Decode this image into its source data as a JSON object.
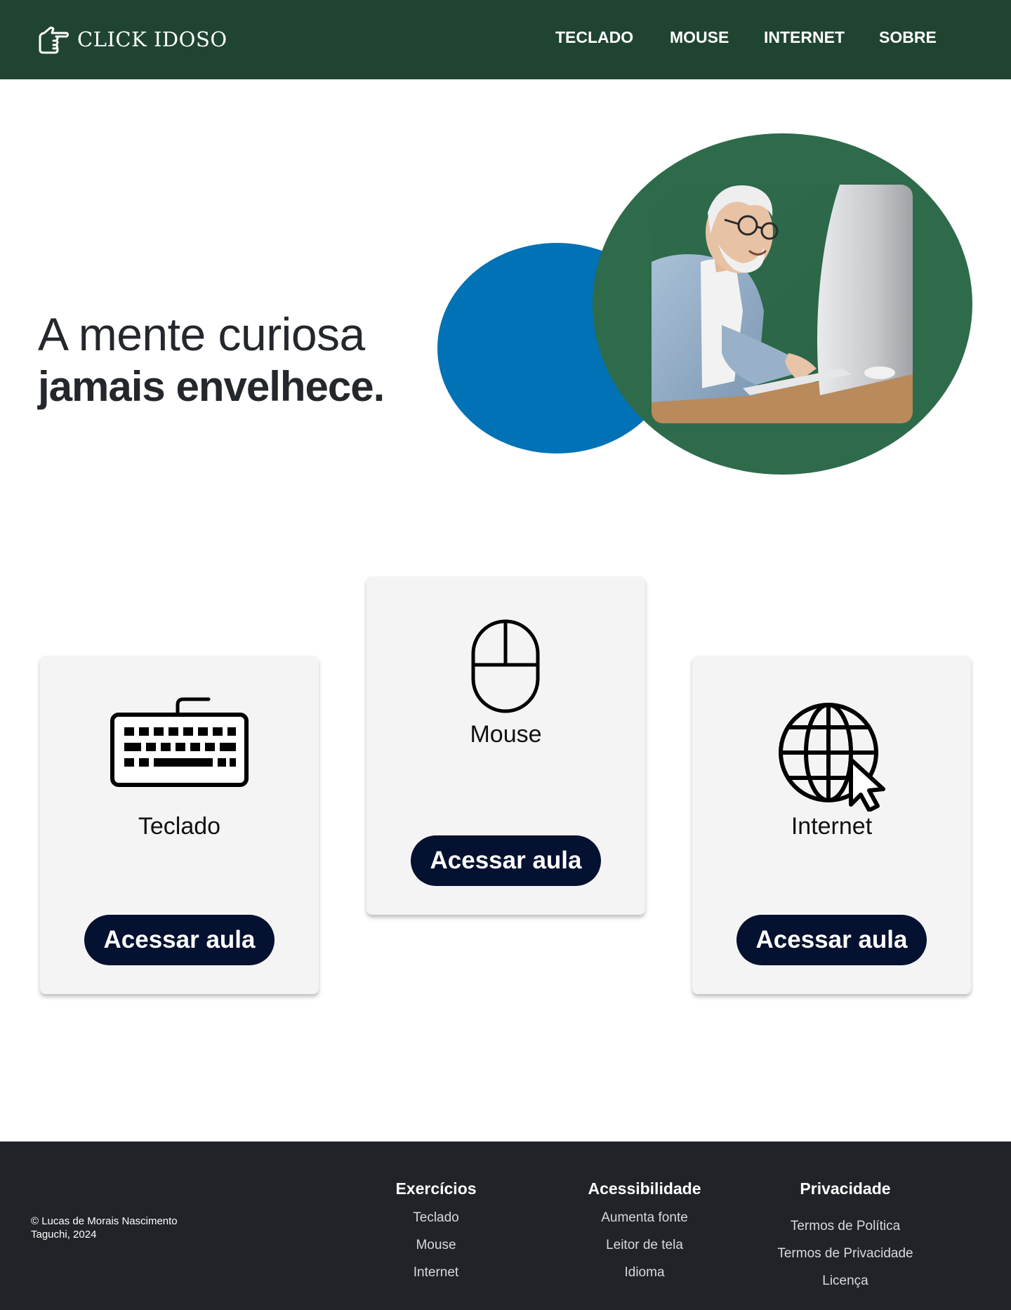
{
  "header": {
    "brand": "CLICK IDOSO",
    "nav": [
      {
        "label": "TECLADO"
      },
      {
        "label": "MOUSE"
      },
      {
        "label": "INTERNET"
      },
      {
        "label": "SOBRE"
      }
    ]
  },
  "hero": {
    "line1": "A mente curiosa",
    "line2": "jamais envelhece."
  },
  "cards": {
    "keyboard": {
      "title": "Teclado",
      "button": "Acessar aula",
      "icon": "keyboard-icon"
    },
    "mouse": {
      "title": "Mouse",
      "button": "Acessar aula",
      "icon": "mouse-icon"
    },
    "internet": {
      "title": "Internet",
      "button": "Acessar aula",
      "icon": "globe-cursor-icon"
    }
  },
  "footer": {
    "copyright_line1": "© Lucas de Morais Nascimento",
    "copyright_line2": "Taguchi, 2024",
    "exercises": {
      "title": "Exercícios",
      "links": [
        "Teclado",
        "Mouse",
        "Internet"
      ]
    },
    "accessibility": {
      "title": "Acessibilidade",
      "links": [
        "Aumenta fonte",
        "Leitor de tela",
        "Idioma"
      ]
    },
    "privacy": {
      "title": "Privacidade",
      "links": [
        "Termos de Política",
        "Termos de Privacidade",
        "Licença"
      ]
    }
  },
  "colors": {
    "header_bg": "#1f4532",
    "accent_green": "#2e6b4b",
    "accent_blue": "#0272b6",
    "button_bg": "#041130",
    "footer_bg": "#202328"
  }
}
